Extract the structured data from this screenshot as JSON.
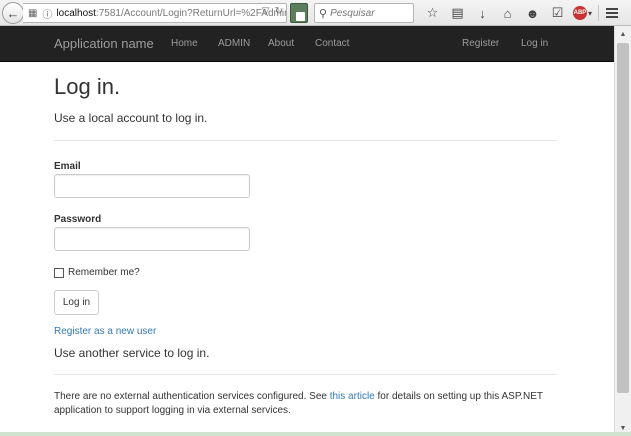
{
  "browser": {
    "url_host": "localhost",
    "url_path": ":7581/Account/Login?ReturnUrl=%2FAdmin",
    "search_placeholder": "Pesquisar"
  },
  "navbar": {
    "brand": "Application name",
    "links": [
      "Home",
      "ADMIN",
      "About",
      "Contact"
    ],
    "right_links": [
      "Register",
      "Log in"
    ]
  },
  "main": {
    "title": "Log in.",
    "subtitle": "Use a local account to log in.",
    "email_label": "Email",
    "email_value": "",
    "password_label": "Password",
    "password_value": "",
    "remember_label": "Remember me?",
    "login_button": "Log in",
    "register_link": "Register as a new user",
    "other_service_title": "Use another service to log in.",
    "external_text_before": "There are no external authentication services configured. See ",
    "external_link": "this article",
    "external_text_after": " for details on setting up this ASP.NET application to support logging in via external services."
  }
}
